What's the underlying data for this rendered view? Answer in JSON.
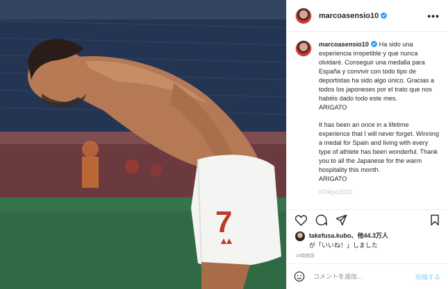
{
  "post": {
    "username": "marcoasensio10",
    "more_label": "•••",
    "caption_es": "Ha sido una experiencia irrepetible y que nunca olvidaré. Conseguir una medalla para España y convivir con todo tipo de deportistas ha sido algo único. Gracias a todos los japoneses por el trato que nos habéis dado todo este mes.\nARIGATO",
    "caption_en": "It has been an once in a lifetime experience that I will never forget. Winning a medal for Spain and living with every type of athlete has been wonderful. Thank you to all the Japanese for the warm hospitality this month.\nARIGATO",
    "hashtag_partial": "#Tokyo2020"
  },
  "likes": {
    "user": "takefusa.kubo",
    "suffix": "、他44.3万人",
    "line2": "が「いいね！」しました"
  },
  "timestamp": "14時間前",
  "comment": {
    "placeholder": "コメントを追加...",
    "post_label": "投稿する"
  },
  "icons": {
    "like": "heart-icon",
    "comment": "comment-icon",
    "share": "share-icon",
    "save": "bookmark-icon",
    "emoji": "emoji-icon"
  },
  "colors": {
    "verified": "#3897f0",
    "post_button": "#b2dffc",
    "secondary_text": "#8e8e8e"
  }
}
